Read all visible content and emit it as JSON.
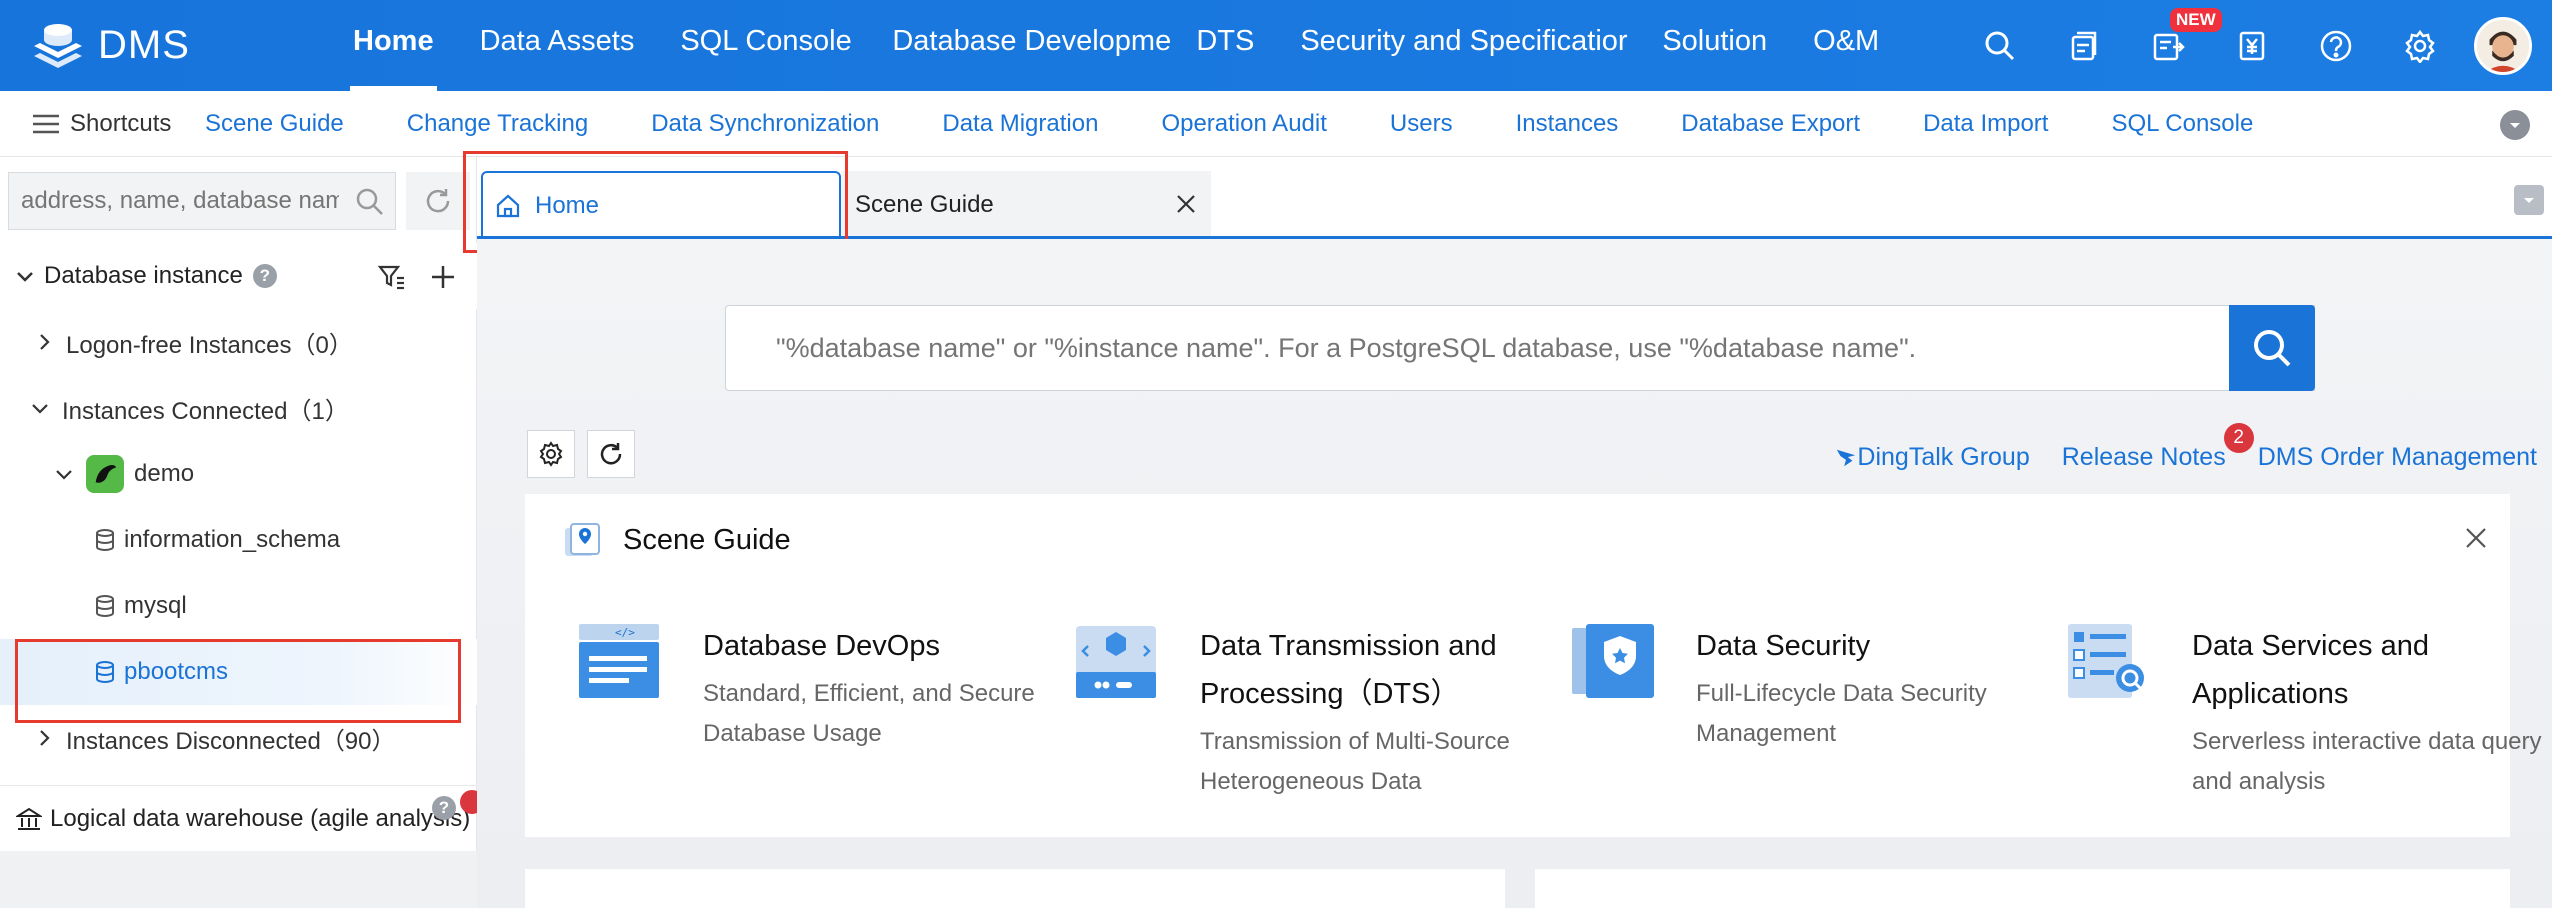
{
  "topnav": {
    "logo_text": "DMS",
    "items": [
      {
        "label": "Home",
        "active": true
      },
      {
        "label": "Data Assets"
      },
      {
        "label": "SQL Console"
      },
      {
        "label": "Database Developmer"
      },
      {
        "label": "DTS"
      },
      {
        "label": "Security and Specificatior"
      },
      {
        "label": "Solution"
      },
      {
        "label": "O&M"
      }
    ],
    "new_badge": "NEW",
    "accent": "#1a73d6"
  },
  "shortcuts": {
    "menu_label": "Shortcuts",
    "links": [
      "Scene Guide",
      "Change Tracking",
      "Data Synchronization",
      "Data Migration",
      "Operation Audit",
      "Users",
      "Instances",
      "Database Export",
      "Data Import",
      "SQL Console"
    ]
  },
  "sidebar": {
    "search_placeholder": "address, name, database nam",
    "header": "Database instance",
    "help_mark": "?",
    "tree": [
      {
        "label": "Logon-free Instances（0）"
      },
      {
        "label": "Instances Connected（1）"
      },
      {
        "label": "demo"
      },
      {
        "label": "information_schema"
      },
      {
        "label": "mysql"
      },
      {
        "label": "pbootcms",
        "selected": true
      },
      {
        "label": "Instances Disconnected（90）"
      }
    ],
    "bottom_label": "Logical data warehouse (agile analysis)"
  },
  "tabs": [
    {
      "label": "Home",
      "active": true
    },
    {
      "label": "Scene Guide"
    }
  ],
  "main": {
    "search_placeholder": "\"%database name\" or \"%instance name\". For a PostgreSQL database, use \"%database name\".",
    "quick_links": [
      {
        "label": "DingTalk Group"
      },
      {
        "label": "Release Notes",
        "badge": "2"
      },
      {
        "label": "DMS Order Management"
      }
    ],
    "scene_guide": {
      "title": "Scene Guide",
      "items": [
        {
          "title": "Database DevOps",
          "desc": "Standard, Efficient, and Secure Database Usage"
        },
        {
          "title": "Data Transmission and Processing（DTS）",
          "desc": "Transmission of Multi-Source Heterogeneous Data"
        },
        {
          "title": "Data Security",
          "desc": "Full-Lifecycle Data Security Management"
        },
        {
          "title": "Data Services and Applications",
          "desc": "Serverless interactive data query and analysis"
        }
      ]
    }
  }
}
